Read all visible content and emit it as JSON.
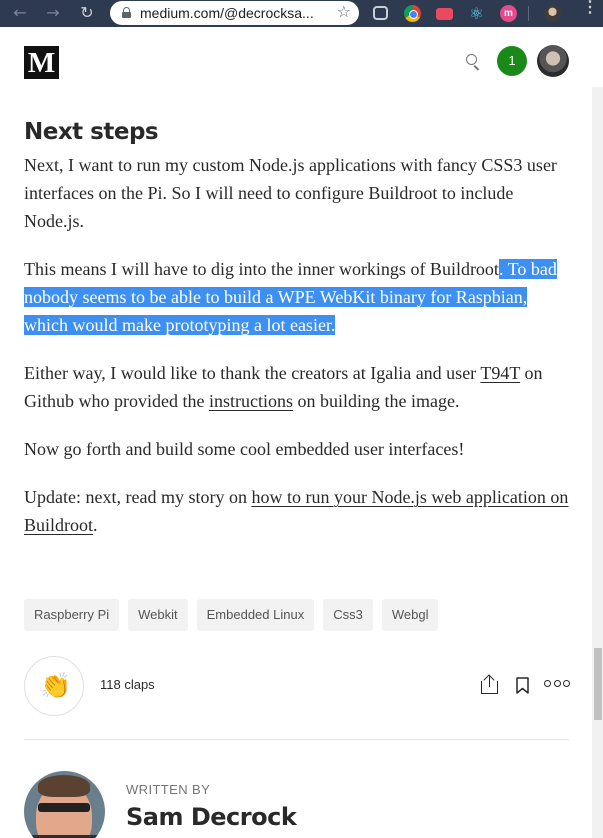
{
  "browser": {
    "back_glyph": "←",
    "forward_glyph": "→",
    "reload_glyph": "↻",
    "url": "medium.com/@decrocksa...",
    "star_glyph": "☆",
    "react_glyph": "⚛",
    "ext_m_label": "m",
    "menu_glyph": "⋮"
  },
  "header": {
    "logo": "M",
    "notification_count": "1"
  },
  "article": {
    "section_title": "Next steps",
    "p1": "Next, I want to run my custom Node.js applications with fancy CSS3 user interfaces on the Pi. So I will need to configure Buildroot to include Node.js.",
    "p2_plain": "This means I will have to dig into the inner workings of Buildroot",
    "p2_selected": ". To bad nobody seems to be able to build a WPE WebKit binary for Raspbian, which would make prototyping a lot easier.",
    "p3_before": "Either way, I would like to thank the creators at Igalia and user ",
    "p3_link1": "T94T",
    "p3_middle": " on Github who provided the ",
    "p3_link2": "instructions",
    "p3_after": " on building the image.",
    "p4": "Now go forth and build some cool embedded user interfaces!",
    "p5_before": "Update: next, read my story on ",
    "p5_link": "how to run your Node.js web application on Buildroot",
    "p5_after": "."
  },
  "tags": [
    "Raspberry Pi",
    "Webkit",
    "Embedded Linux",
    "Css3",
    "Webgl"
  ],
  "claps": {
    "count_label": "118 claps",
    "clap_glyph": "👏"
  },
  "author": {
    "written_by": "WRITTEN BY",
    "name": "Sam Decrock"
  }
}
